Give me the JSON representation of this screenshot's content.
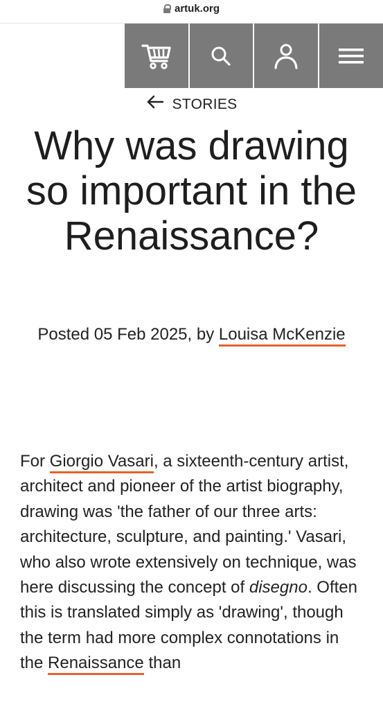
{
  "browser": {
    "url": "artuk.org"
  },
  "nav": {
    "items": [
      {
        "name": "cart",
        "icon": "cart-icon"
      },
      {
        "name": "search",
        "icon": "search-icon"
      },
      {
        "name": "account",
        "icon": "user-icon"
      },
      {
        "name": "menu",
        "icon": "hamburger-menu-icon"
      }
    ],
    "background": "#7a7a7a"
  },
  "breadcrumb": {
    "label": "STORIES",
    "icon": "arrow-left-icon"
  },
  "article": {
    "title": "Why was drawing so important in the Renaissance?",
    "byline_prefix": "Posted 05 Feb 2025, by ",
    "author": "Louisa McKenzie",
    "body": {
      "part1": "For ",
      "link1": "Giorgio Vasari",
      "part2": ", a sixteenth-century artist, architect and pioneer of the artist biography, drawing was 'the father of our three arts: architecture, sculpture, and painting.' Vasari, who also wrote extensively on technique, was here discussing the concept of ",
      "emphasis": "disegno",
      "part3": ". Often this is translated simply as 'drawing', though the term had more complex connotations in the ",
      "link2": "Renaissance",
      "part4": " than"
    }
  },
  "colors": {
    "accent_underline": "#e4622b",
    "nav_bg": "#7a7a7a",
    "text": "#222222"
  }
}
